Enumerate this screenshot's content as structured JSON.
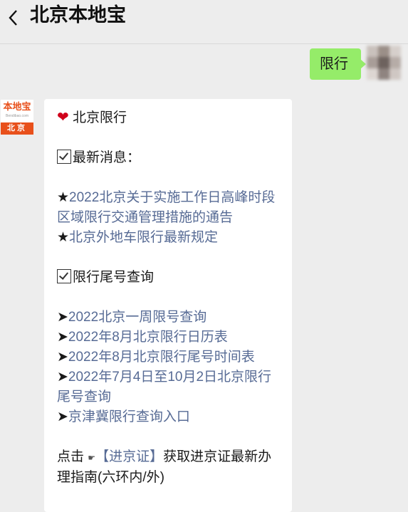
{
  "header": {
    "title": "北京本地宝"
  },
  "outgoing": {
    "text": "限行"
  },
  "bot": {
    "logo_top": "本地宝",
    "logo_small": "Bendibao.com",
    "logo_bottom": "北京"
  },
  "message": {
    "title": "北京限行",
    "section1": "最新消息：",
    "news": [
      "2022北京关于实施工作日高峰时段区域限行交通管理措施的通告",
      "北京外地车限行最新规定"
    ],
    "star": "★",
    "section2": "限行尾号查询",
    "queries": [
      "2022北京一周限号查询",
      "2022年8月北京限行日历表",
      "2022年8月北京限行尾号时间表",
      "2022年7月4日至10月2日北京限行尾号查询",
      "京津冀限行查询入口"
    ],
    "arrow": "➤",
    "footer_prefix": "点击",
    "footer_link": "【进京证】",
    "footer_suffix": "获取进京证最新办理指南(六环内/外)"
  }
}
